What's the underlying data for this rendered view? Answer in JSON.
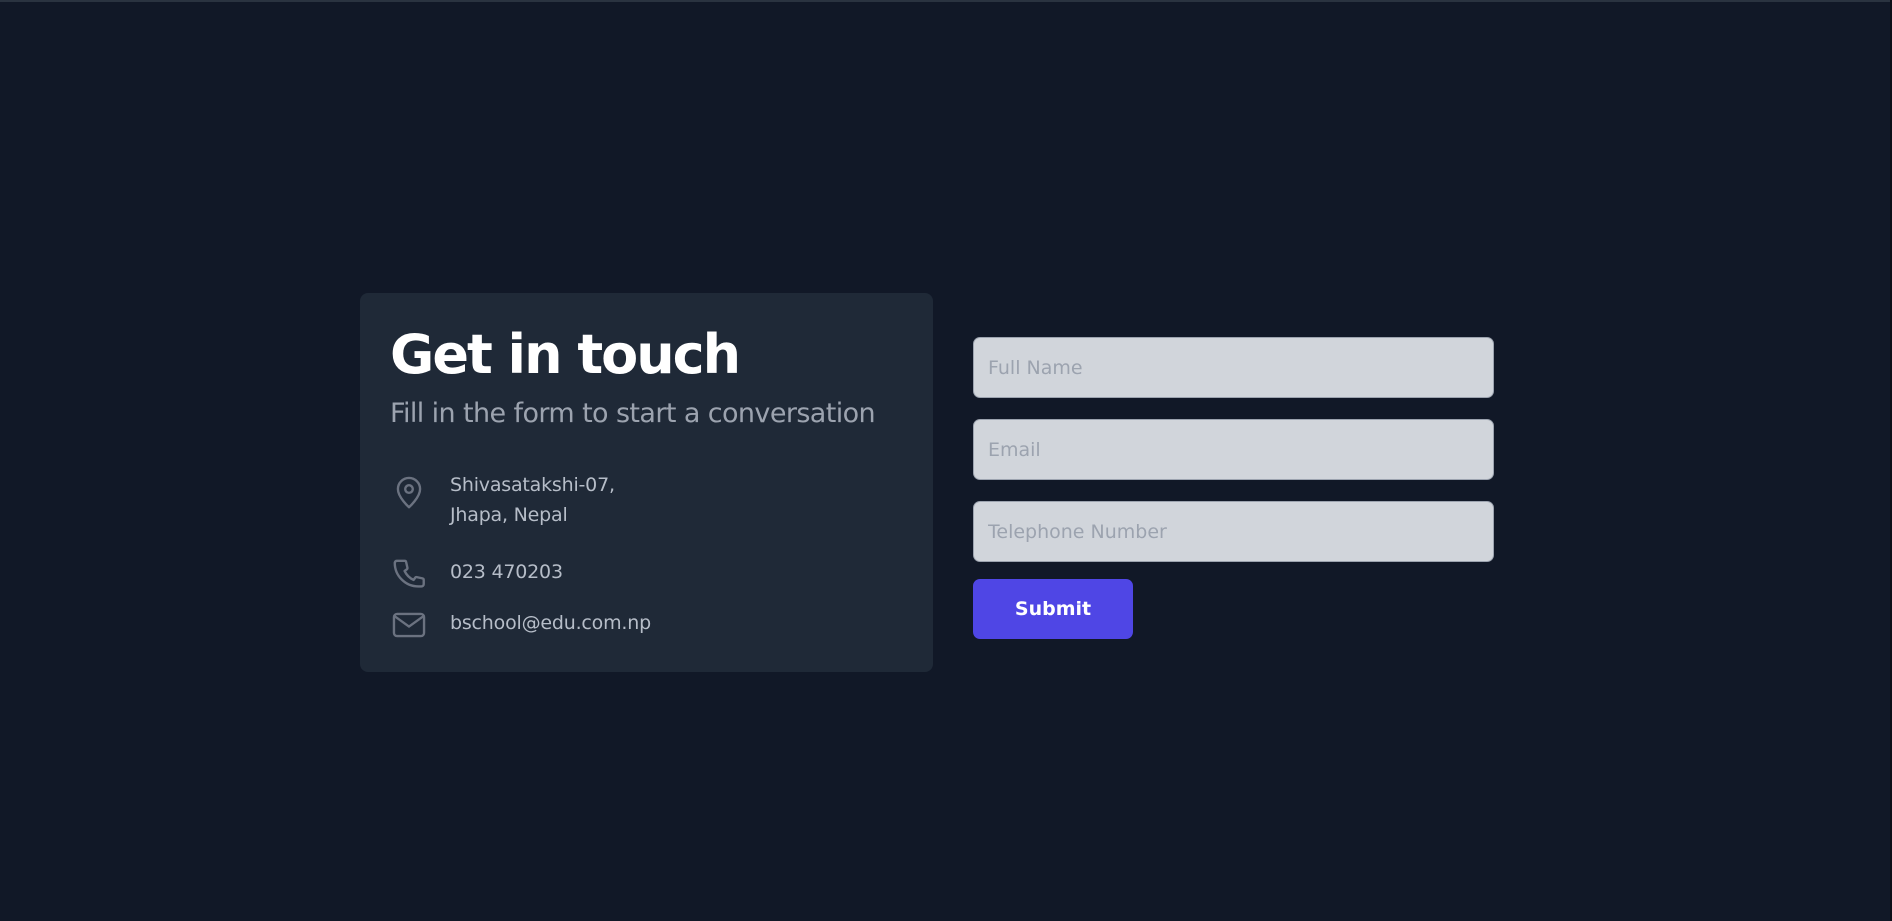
{
  "contact_panel": {
    "title": "Get in touch",
    "subtitle": "Fill in the form to start a conversation",
    "address": {
      "icon": "location-pin-icon",
      "line1": "Shivasatakshi-07,",
      "line2": "Jhapa, Nepal"
    },
    "phone": {
      "icon": "phone-icon",
      "value": "023 470203"
    },
    "email": {
      "icon": "envelope-icon",
      "value": "bschool@edu.com.np"
    }
  },
  "form": {
    "full_name": {
      "placeholder": "Full Name",
      "value": ""
    },
    "email": {
      "placeholder": "Email",
      "value": ""
    },
    "telephone": {
      "placeholder": "Telephone Number",
      "value": ""
    },
    "submit_label": "Submit"
  },
  "colors": {
    "page_background": "#111827",
    "card_background": "#1f2937",
    "input_background": "#d1d5db",
    "accent": "#4f46e5",
    "muted_text": "#9ca3af"
  }
}
